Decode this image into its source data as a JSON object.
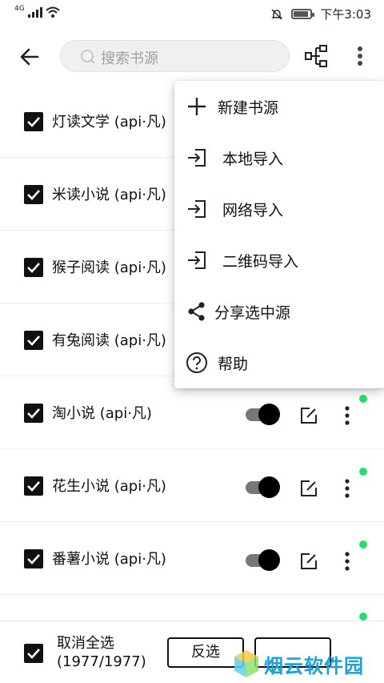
{
  "status_bar": {
    "network": "4G",
    "time": "下午3:03"
  },
  "toolbar": {
    "search_placeholder": "搜索书源"
  },
  "sources": [
    {
      "name": "灯读文学 (api·凡)",
      "checked": true,
      "enabled": true
    },
    {
      "name": "米读小说 (api·凡)",
      "checked": true,
      "enabled": true
    },
    {
      "name": "猴子阅读 (api·凡)",
      "checked": true,
      "enabled": true
    },
    {
      "name": "有兔阅读 (api·凡)",
      "checked": true,
      "enabled": true
    },
    {
      "name": "淘小说 (api·凡)",
      "checked": true,
      "enabled": true
    },
    {
      "name": "花生小说 (api·凡)",
      "checked": true,
      "enabled": true
    },
    {
      "name": "番薯小说 (api·凡)",
      "checked": true,
      "enabled": true
    }
  ],
  "menu": {
    "items": [
      {
        "label": "新建书源",
        "icon": "plus-icon"
      },
      {
        "label": "本地导入",
        "icon": "import-icon"
      },
      {
        "label": "网络导入",
        "icon": "import-icon"
      },
      {
        "label": "二维码导入",
        "icon": "import-icon"
      },
      {
        "label": "分享选中源",
        "icon": "share-icon"
      },
      {
        "label": "帮助",
        "icon": "help-icon"
      }
    ]
  },
  "bottom_bar": {
    "select_label": "取消全选",
    "count": "(1977/1977)",
    "invert_label": "反选"
  },
  "watermark": {
    "text": "烟云软件园"
  },
  "colors": {
    "status_dot": "#22e06b",
    "watermark": "#1aa3d9"
  }
}
